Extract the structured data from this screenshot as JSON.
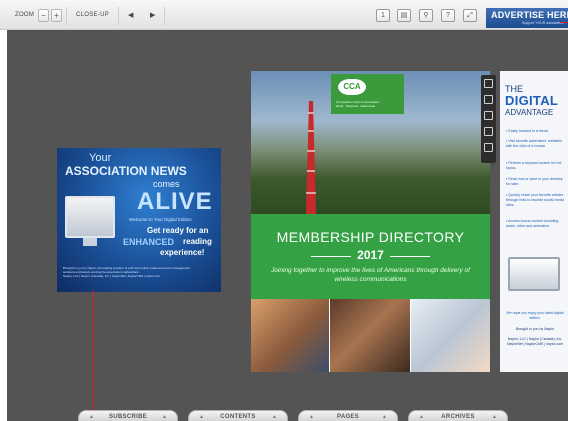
{
  "toolbar": {
    "zoom_label": "ZOOM",
    "zoom_out": "−",
    "zoom_in": "+",
    "closeup_label": "CLOSE-UP",
    "prev": "◀",
    "next": "▶",
    "icon_page_num": "1",
    "icon_page": "▤",
    "icon_search": "⚲",
    "icon_help": "?",
    "icon_fullscreen": "⤢",
    "advertise_text": "ADVERTISE HERE",
    "advertise_sub": "Support YOUR association"
  },
  "assoc_ad": {
    "line1": "Your",
    "line2": "ASSOCIATION NEWS",
    "line3": "comes",
    "line4": "ALIVE",
    "line5": "Welcome to Your Digital Edition",
    "line6": "Get ready for an",
    "line7a": "ENHANCED",
    "line7b": "reading",
    "line8": "experience!",
    "fine1": "Brought to you by Naylor, the leading provider of print and online media and event management",
    "fine2": "solutions exclusively serving the association marketplace.",
    "fine3": "Naylor, LLC | Naylor (Canada), Inc. | NaylorNet | NaylorCMS | naylor.com"
  },
  "cover": {
    "logo": "CCA",
    "org_name": "Competitive Carriers Association",
    "org_tag": "Rural · Regional · Nationwide",
    "title": "MEMBERSHIP DIRECTORY",
    "year": "2017",
    "tagline": "Joining together to improve the lives of Americans through delivery of wireless communications"
  },
  "digital_panel": {
    "h1": "THE",
    "h2": "DIGITAL",
    "h3": "ADVANTAGE",
    "bullets": [
      "• Easily forward to a friend.",
      "• Visit favorite advertisers' websites with the click of a mouse.",
      "• Perform a keyword search for hot topics.",
      "• Read now or save to your desktop for later.",
      "• Quickly share your favorite articles through links to favorite social media sites.",
      "• Access bonus content including audio, video and animation."
    ],
    "footer1": "We hope you enjoy your latest digital edition.",
    "footer2": "Brought to you by Naylor",
    "footer3": "Naylor, LLC | Naylor (Canada), Inc. NaylorNet | NaylorCMS | naylor.com"
  },
  "bottom_tabs": [
    {
      "label": "SUBSCRIBE"
    },
    {
      "label": "CONTENTS"
    },
    {
      "label": "PAGES"
    },
    {
      "label": "ARCHIVES"
    }
  ],
  "colors": {
    "stage": "#545454",
    "cover_green": "#34a244",
    "ad_blue": "#1a4e95",
    "accent_red": "#d41e2a"
  }
}
